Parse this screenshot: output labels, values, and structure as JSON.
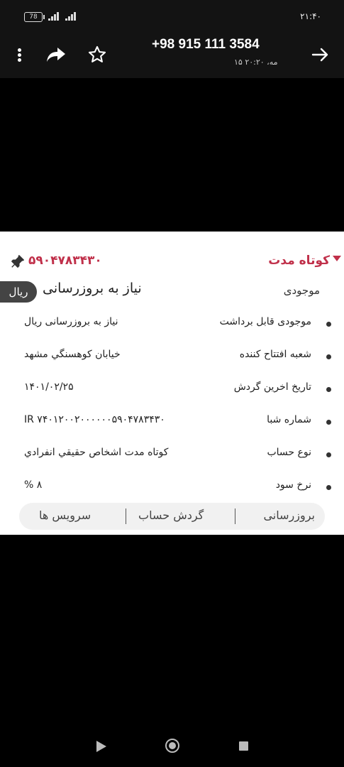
{
  "status_bar": {
    "battery": "78",
    "time": "۲۱:۴۰"
  },
  "app_bar": {
    "phone_number": "+98 915 111 3584",
    "date_time": "۱۵ مه، ۲۰:۲۰",
    "icons": [
      "more-vert-icon",
      "forward-icon",
      "star-outline-icon",
      "arrow-back-icon"
    ]
  },
  "card": {
    "account_type": "کوتاه مدت",
    "account_number": "۵۹۰۴۷۸۳۴۳۰",
    "balance_label": "موجودی",
    "balance_value": "نیاز به بروزرسانی",
    "currency": "ریال",
    "accent_color": "#c0304a",
    "details": [
      {
        "label": "موجودی قابل برداشت",
        "value": "نیاز به بروزرسانی ریال"
      },
      {
        "label": "شعبه افتتاح کننده",
        "value": "خيابان کوهسنگي مشهد"
      },
      {
        "label": "تاریخ اخرین گردش",
        "value": "۱۴۰۱/۰۲/۲۵"
      },
      {
        "label": "شماره شبا",
        "value": "IR ۷۴۰۱۲۰۰۲۰۰۰۰۰۰۵۹۰۴۷۸۳۴۳۰"
      },
      {
        "label": "نوع حساب",
        "value": "کوتاه مدت اشخاص حقيقي انفرادي"
      },
      {
        "label": "نرخ سود",
        "value": "% ۸"
      }
    ],
    "tabs": {
      "refresh": "بروزرسانی",
      "turnover": "گردش حساب",
      "services": "سرویس ها"
    }
  }
}
